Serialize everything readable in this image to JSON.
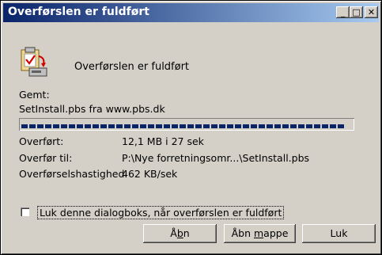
{
  "window": {
    "title": "Overførslen er fuldført"
  },
  "title_buttons": {
    "minimize": "_",
    "maximize": "□",
    "close": "✕"
  },
  "message": "Overførslen er fuldført",
  "saved": {
    "label": "Gemt:",
    "file": "SetInstall.pbs fra www.pbs.dk"
  },
  "progress": {
    "percent": 100
  },
  "details": [
    {
      "label": "Overført:",
      "value": "12,1 MB i 27 sek"
    },
    {
      "label": "Overfør til:",
      "value": "P:\\Nye forretningsomr...\\SetInstall.pbs"
    },
    {
      "label": "Overførselshastighed",
      "value": "462 KB/sek"
    }
  ],
  "checkbox": {
    "label": "Luk denne dialogboks, når overførslen er fuldført",
    "checked": false
  },
  "buttons": {
    "open": {
      "pre": "Å",
      "u": "b",
      "post": "n"
    },
    "open_folder": {
      "pre": "Åbn ",
      "u": "m",
      "post": "appe"
    },
    "close": {
      "label": "Luk"
    }
  },
  "icons": {
    "dialog_icon": "download-complete-icon"
  },
  "colors": {
    "titlebar_start": "#0a246a",
    "titlebar_end": "#a6caf0",
    "progress": "#0a246a",
    "face": "#d4d0c8"
  }
}
